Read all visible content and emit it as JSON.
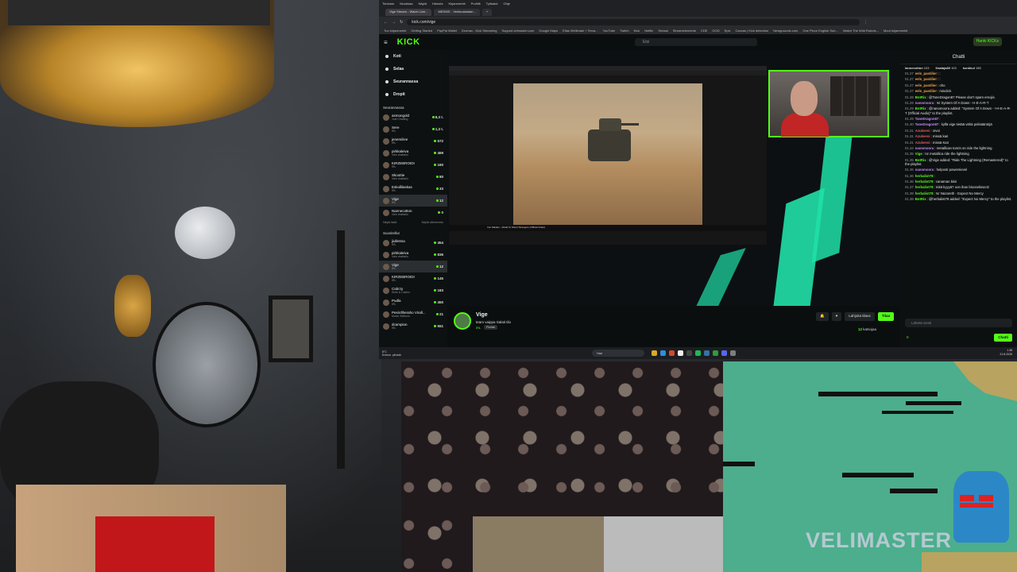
{
  "browser": {
    "menu": [
      "Tiedosto",
      "Muokkaa",
      "Näytä",
      "Historia",
      "Kirjanmerkit",
      "Profiilit",
      "Työkalut",
      "Ohje"
    ],
    "tabs": [
      "Vige Stream - Watch Live...",
      "MEDIKE - Verkkoalustan...",
      "+"
    ],
    "url": "kick.com/vige",
    "bookmarks": [
      "Tuo kirjanmerkit",
      "Getting Started",
      "PayPal Wallet",
      "Dromax - Kick Streaming",
      "Support.velmaster.com",
      "Google Maps",
      "Elias Wellimaki + Terva...",
      "YouTube",
      "Twitch",
      "Kick",
      "Netflix",
      "Seriaal",
      "Streamelements",
      "CDE",
      "GOG",
      "Epic",
      "Canvas | Kick detection",
      "Newgrounds.com",
      "One Piece English Sub...",
      "Watch The Wild Robots...",
      "Muut kirjanmerkit"
    ]
  },
  "kick": {
    "logo": "KICK",
    "search_placeholder": "Etsi",
    "join_label": "Hanki KICKs",
    "nav": [
      {
        "label": "Koti"
      },
      {
        "label": "Selaa"
      },
      {
        "label": "Seurannassa"
      },
      {
        "label": "Dropit"
      }
    ],
    "following_title": "Seurannassa",
    "following": [
      {
        "name": "asmongold",
        "sub": "Just Chatting",
        "viewers": "8,3 t."
      },
      {
        "name": "Sere",
        "sub": "IRL",
        "viewers": "1,3 t."
      },
      {
        "name": "jenemiilee",
        "sub": "IRL",
        "viewers": "572"
      },
      {
        "name": "pirkkaleiva",
        "sub": "Vain chattailu",
        "viewers": "469"
      },
      {
        "name": "KIRZEBROIDI",
        "sub": "IRL",
        "viewers": "160"
      },
      {
        "name": "Skoottie",
        "sub": "Vain chattailu",
        "viewers": "80"
      },
      {
        "name": "Eskollilaskas",
        "sub": "IRL",
        "viewers": "33"
      },
      {
        "name": "Vige",
        "sub": "IRL",
        "viewers": "12"
      },
      {
        "name": "Nannecotton",
        "sub": "Vain chattailu",
        "viewers": "0"
      }
    ],
    "show_more": "Näytä lisää",
    "show_less": "Näytä vähemmän",
    "recommended_title": "Suositellut",
    "recommended": [
      {
        "name": "jiulleSsa",
        "sub": "IRL",
        "viewers": "454"
      },
      {
        "name": "pirkkaleiva",
        "sub": "Vain chattailu",
        "viewers": "836"
      },
      {
        "name": "Vige",
        "sub": "IRL",
        "viewers": "12"
      },
      {
        "name": "KIRZEBROIDI",
        "sub": "IRL",
        "viewers": "145"
      },
      {
        "name": "Cabrzy",
        "sub": "Slots & Casino",
        "viewers": "183"
      },
      {
        "name": "Pudla",
        "sub": "IRL",
        "viewers": "450"
      },
      {
        "name": "PesiVilheraho Virall...",
        "sub": "Music Stations",
        "viewers": "21"
      },
      {
        "name": "dcampion",
        "sub": "IRL",
        "viewers": "551"
      }
    ],
    "stream": {
      "name": "Vige",
      "title": "team vaippa Salati tilo",
      "language": "IRL",
      "tag": "Finnish",
      "gift_label": "Lahjoita tilaus",
      "subscribe_label": "Tilaa",
      "viewers": "12",
      "viewers_label": "katsojaa",
      "inner_video_title": "Iron Maiden - Afraid To Shoot Strangers (Official Video)"
    },
    "chat": {
      "title": "Chatti",
      "pinned": [
        {
          "user": "lannecotton",
          "value": "103"
        },
        {
          "user": "Kaalaja80",
          "value": "103"
        },
        {
          "user": "kunkkul",
          "value": "185"
        }
      ],
      "messages": [
        {
          "t": "01.27",
          "u": "eels_pastilier",
          "c": "#f0a24b",
          "m": ":"
        },
        {
          "t": "01.27",
          "u": "eels_pastilier",
          "c": "#f0a24b",
          "m": ":"
        },
        {
          "t": "01.27",
          "u": "eels_pastilier",
          "c": "#f0a24b",
          "m": "oho"
        },
        {
          "t": "01.27",
          "u": "eels_pastilier",
          "c": "#f0a24b",
          "m": "misclick"
        },
        {
          "t": "01.28",
          "u": "BotRix",
          "c": "#53fc18",
          "m": "@TaneDragon87 Please don't spam emojis."
        },
        {
          "t": "01.29",
          "u": "nanomoora",
          "c": "#c58af9",
          "m": "!sr System Of A Down - H-E-A-R-T"
        },
        {
          "t": "01.29",
          "u": "BotRix",
          "c": "#53fc18",
          "m": "@nanomoora added: \"System Of A Down - !-H-E-A-R-T (Official Audio)\" to the playlist."
        },
        {
          "t": "01.29",
          "u": "TaneDragon87",
          "c": "#c58af9",
          "m": ""
        },
        {
          "t": "01.30",
          "u": "TaneDragon87",
          "c": "#c58af9",
          "m": "kyllä vige tietää vähä pelisääntöjä"
        },
        {
          "t": "01.31",
          "u": "Azukeeni",
          "c": "#e25c5c",
          "m": "oivoi"
        },
        {
          "t": "01.31",
          "u": "Azukeeni",
          "c": "#e25c5c",
          "m": "missä kari"
        },
        {
          "t": "01.31",
          "u": "Azukeeni",
          "c": "#e25c5c",
          "m": "missä Kari"
        },
        {
          "t": "01.34",
          "u": "nanomoora",
          "c": "#c58af9",
          "m": "metallican tonrin on ride the lightning"
        },
        {
          "t": "01.35",
          "u": "Vige",
          "c": "#53fc18",
          "m": "!sr metallica ride the lightning"
        },
        {
          "t": "01.35",
          "u": "BotRix",
          "c": "#53fc18",
          "m": "@Vige added: \"Ride The Lightning (Remastered)\" to the playlist."
        },
        {
          "t": "01.36",
          "u": "nanomoora",
          "c": "#c58af9",
          "m": "helposti powersievel"
        },
        {
          "t": "01.36",
          "u": "herbalist78",
          "c": "#53fc18",
          "m": ""
        },
        {
          "t": "01.36",
          "u": "herbalist78",
          "c": "#53fc18",
          "m": "canaman biisi"
        },
        {
          "t": "01.37",
          "u": "herbalist78",
          "c": "#53fc18",
          "m": "mitä kyyyä? oon ihan blooselissa:D"
        },
        {
          "t": "01.38",
          "u": "herbalist78",
          "c": "#53fc18",
          "m": "!sr Nazareth - Expect No Mercy"
        },
        {
          "t": "01.38",
          "u": "BotRix",
          "c": "#53fc18",
          "m": "@herbalist78 added: \"Expect No Mercy\" to the playlist."
        }
      ],
      "input_placeholder": "Lähetä viesti",
      "send_label": "Chatti",
      "points": "0"
    }
  },
  "taskbar": {
    "weather_temp": "8°C",
    "weather_desc": "Enimm. pilvistä",
    "search_placeholder": "Hae",
    "time": "1.38",
    "date": "21.8.2025"
  },
  "overlay": {
    "brand": "VELIMASTER"
  },
  "colors": {
    "kick_green": "#53fc18",
    "game_green": "#4cae8c",
    "accent_teal": "#20e0a8"
  }
}
